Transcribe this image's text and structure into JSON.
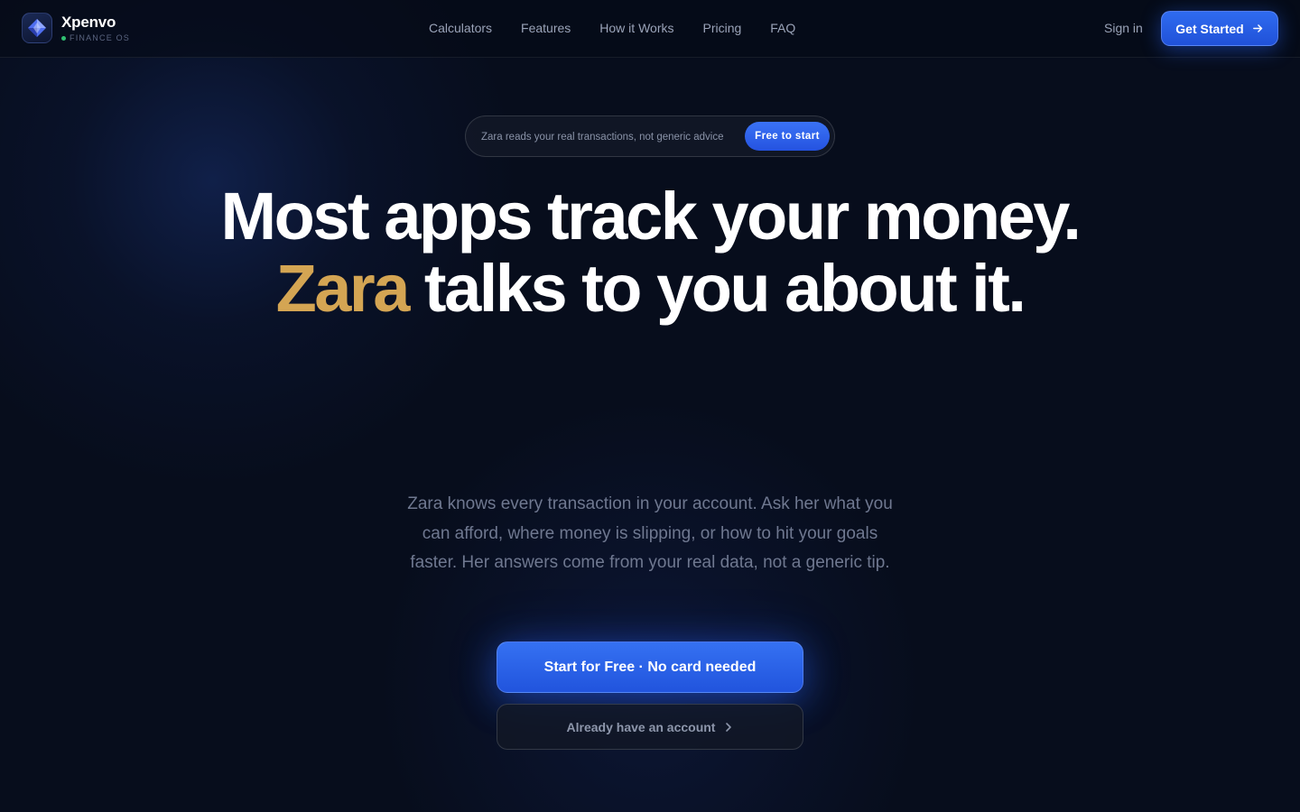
{
  "nav": {
    "brand_name": "Xpenvo",
    "brand_tag": "FINANCE OS",
    "links": [
      "Calculators",
      "Features",
      "How it Works",
      "Pricing",
      "FAQ"
    ],
    "signin": "Sign in",
    "get_started": "Get Started"
  },
  "hero": {
    "badge_text": "Zara reads your real transactions, not generic advice",
    "badge_cta": "Free to start",
    "headline_line1": "Most apps track your money.",
    "headline_accent": "Zara",
    "headline_line2_rest": " talks to you about it.",
    "subtext": "Zara knows every transaction in your account. Ask her what you can afford, where money is slipping, or how to hit your goals faster. Her answers come from your real data, not a generic tip.",
    "primary_cta": "Start for Free · No card needed",
    "secondary_cta": "Already have an account"
  },
  "colors": {
    "background": "#070d1c",
    "accent_blue": "#2f6bf0",
    "accent_gold": "#d4a553",
    "status_green": "#2fbf71"
  },
  "icons": {
    "logo": "diamond-logo-icon",
    "get_started": "arrow-right-icon",
    "secondary_cta": "chevron-right-icon"
  }
}
